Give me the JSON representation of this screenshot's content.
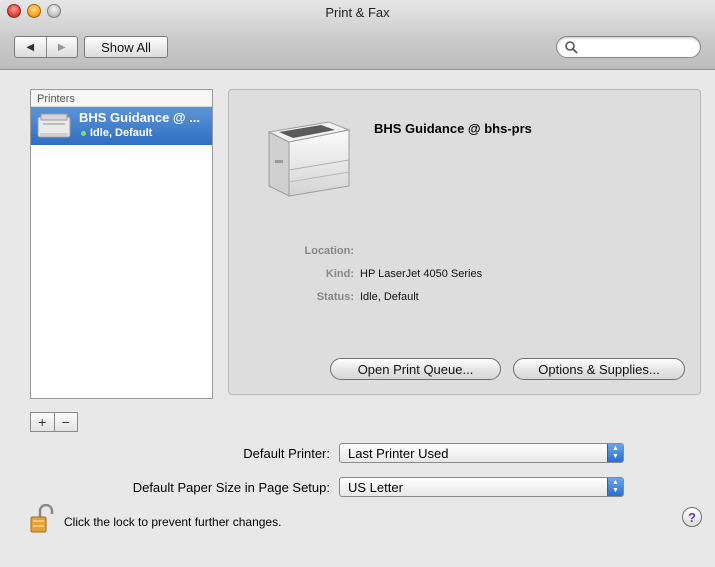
{
  "window": {
    "title": "Print & Fax"
  },
  "toolbar": {
    "show_all_label": "Show All",
    "back_icon": "◀",
    "forward_icon": "▶",
    "search_value": "",
    "search_placeholder": ""
  },
  "printers": {
    "header": "Printers",
    "items": [
      {
        "name": "BHS Guidance @ ...",
        "status": "Idle, Default"
      }
    ]
  },
  "list_controls": {
    "add_label": "+",
    "remove_label": "−"
  },
  "detail": {
    "printer_name": "BHS Guidance @ bhs-prs",
    "location_label": "Location:",
    "location_value": "",
    "kind_label": "Kind:",
    "kind_value": "HP LaserJet 4050 Series",
    "status_label": "Status:",
    "status_value": "Idle, Default",
    "open_queue_label": "Open Print Queue...",
    "options_label": "Options & Supplies..."
  },
  "settings": {
    "default_printer_label": "Default Printer:",
    "default_printer_value": "Last Printer Used",
    "paper_size_label": "Default Paper Size in Page Setup:",
    "paper_size_value": "US Letter"
  },
  "footer": {
    "lock_text": "Click the lock to prevent further changes.",
    "help_label": "?"
  },
  "colors": {
    "selection": "#2f6fc2",
    "idle_dot": "#79e36a",
    "popup_arrow": "#2d6ec8"
  }
}
